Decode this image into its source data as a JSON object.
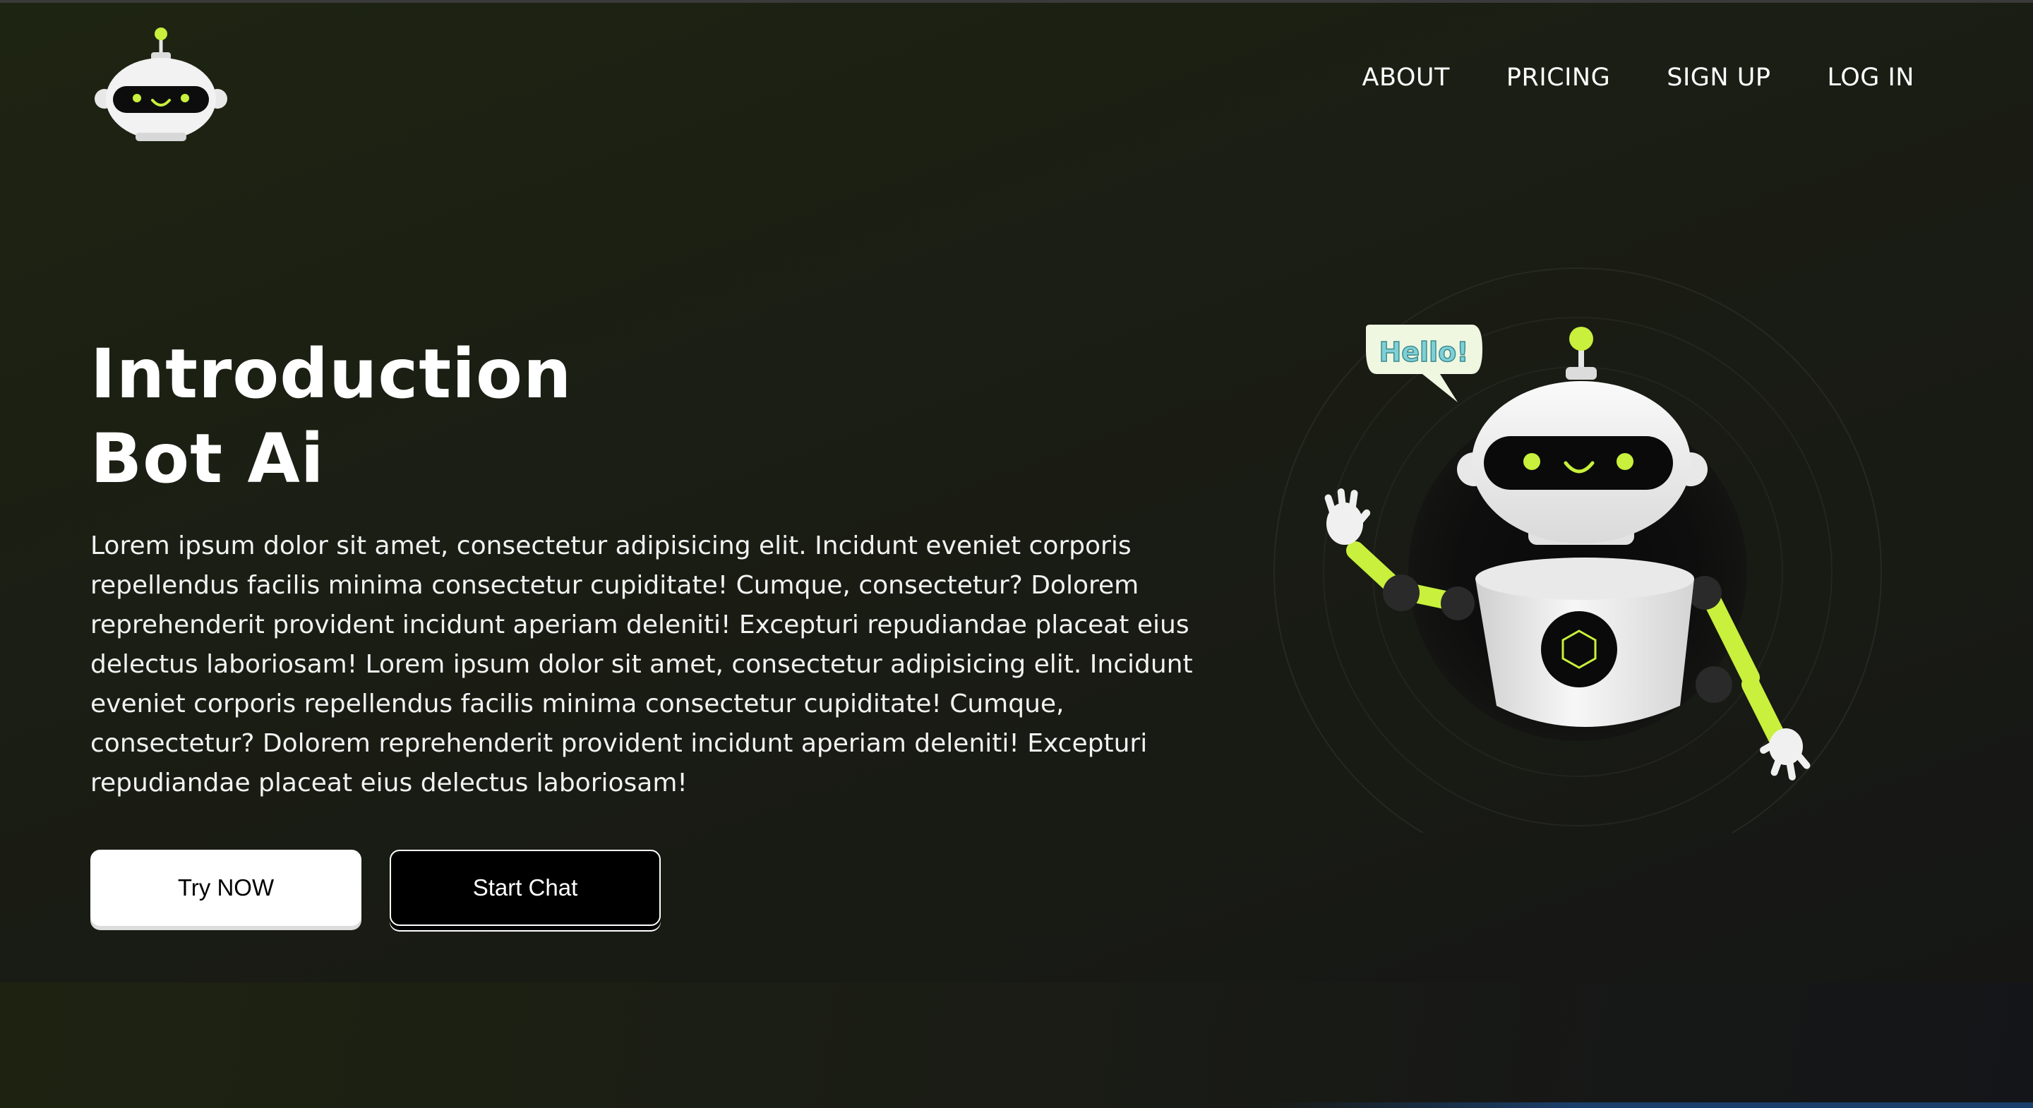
{
  "brand": {
    "logo_icon": "robot-head-icon"
  },
  "nav": {
    "items": [
      "ABOUT",
      "PRICING",
      "SIGN UP",
      "LOG IN"
    ]
  },
  "hero": {
    "title_line1": "Introduction",
    "title_line2": "Bot Ai",
    "description": "Lorem ipsum dolor sit amet, consectetur adipisicing elit. Incidunt eveniet corporis repellendus facilis minima consectetur cupiditate! Cumque, consectetur? Dolorem reprehenderit provident incidunt aperiam deleniti! Excepturi repudiandae placeat eius delectus laboriosam! Lorem ipsum dolor sit amet, consectetur adipisicing elit. Incidunt eveniet corporis repellendus facilis minima consectetur cupiditate! Cumque, consectetur? Dolorem reprehenderit provident incidunt aperiam deleniti! Excepturi repudiandae placeat eius delectus laboriosam!",
    "primary_button": "Try NOW",
    "secondary_button": "Start Chat"
  },
  "illustration": {
    "speech_bubble": "Hello!",
    "icon": "waving-robot-illustration"
  },
  "colors": {
    "accent": "#c8f03c",
    "background": "#1a1d14"
  }
}
